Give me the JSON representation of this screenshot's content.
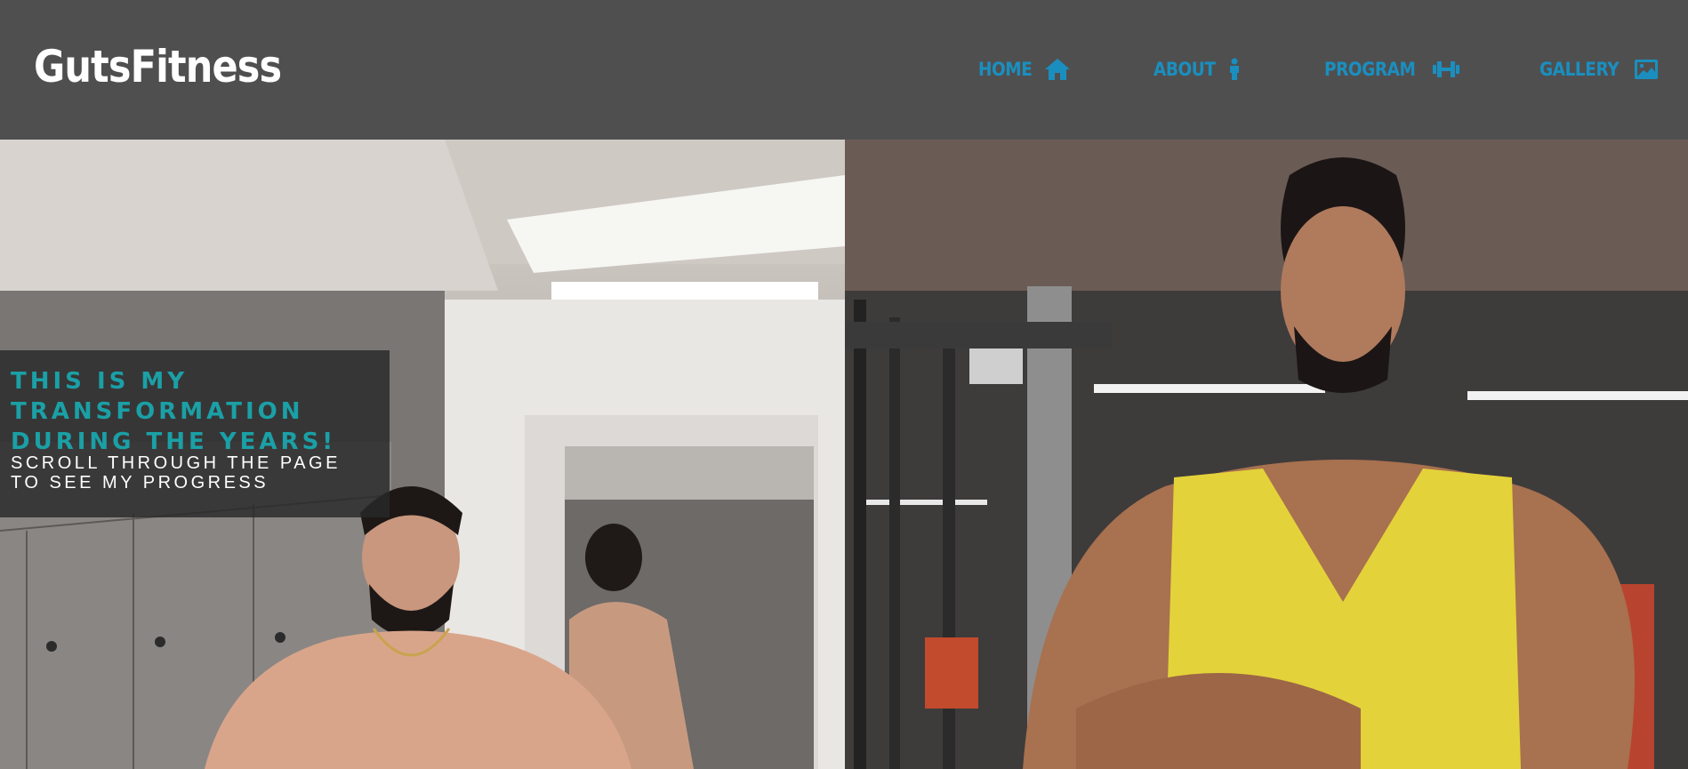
{
  "brand": {
    "name": "GutsFitness"
  },
  "nav": {
    "items": [
      {
        "label": "HOME",
        "icon": "home-icon"
      },
      {
        "label": "ABOUT",
        "icon": "person-icon"
      },
      {
        "label": "PROGRAM",
        "icon": "dumbbell-icon"
      },
      {
        "label": "GALLERY",
        "icon": "image-icon"
      }
    ]
  },
  "hero": {
    "heading": "THIS IS MY TRANSFORMATION DURING THE YEARS!",
    "subheading": "SCROLL THROUGH THE PAGE TO SEE MY PROGRESS"
  },
  "colors": {
    "header_bg": "#4f4f50",
    "brand": "#ffffff",
    "nav_link": "#1a8fbf",
    "heading_accent": "#1aa0a6"
  }
}
